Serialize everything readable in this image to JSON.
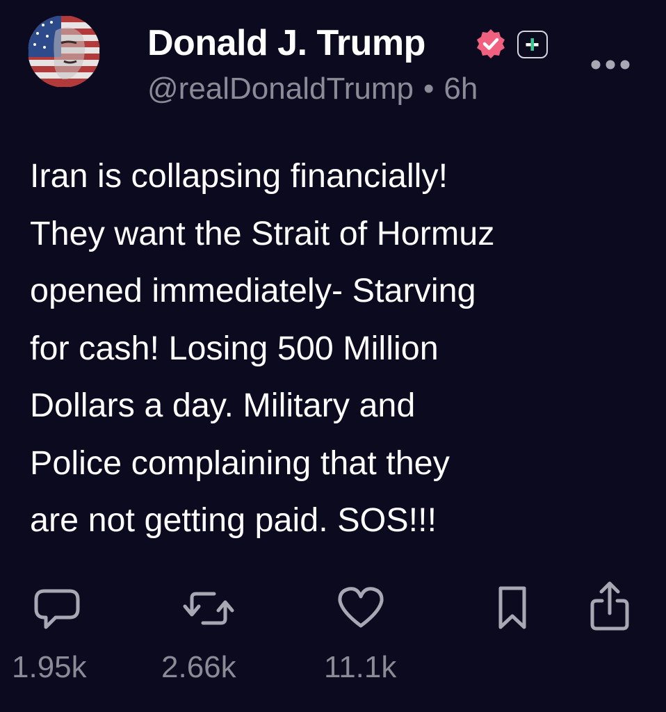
{
  "post": {
    "author": {
      "display_name": "Donald J. Trump",
      "handle": "@realDonaldTrump",
      "separator": "•",
      "time_ago": "6h",
      "avatar_icon": "flag-portrait-avatar",
      "verified_icon": "verified-badge-icon",
      "plus_icon": "plus-badge-icon"
    },
    "body": "Iran is collapsing financially!\nThey want the Strait of Hormuz\nopened immediately- Starving\nfor cash! Losing 500 Million\nDollars a day. Military and\nPolice complaining that they\nare not getting paid. SOS!!!",
    "actions": {
      "reply": {
        "icon": "reply-icon",
        "count": "1.95k"
      },
      "repost": {
        "icon": "repost-icon",
        "count": "2.66k"
      },
      "like": {
        "icon": "heart-icon",
        "count": "11.1k"
      },
      "bookmark": {
        "icon": "bookmark-icon"
      },
      "share": {
        "icon": "share-icon"
      }
    },
    "more_icon": "more-horizontal-icon"
  },
  "colors": {
    "background": "#0b0a1f",
    "text": "#ffffff",
    "muted": "#8b8b97",
    "icon": "#a8a8b4",
    "verified": "#f2607f",
    "plus_accent": "#37c98f"
  }
}
